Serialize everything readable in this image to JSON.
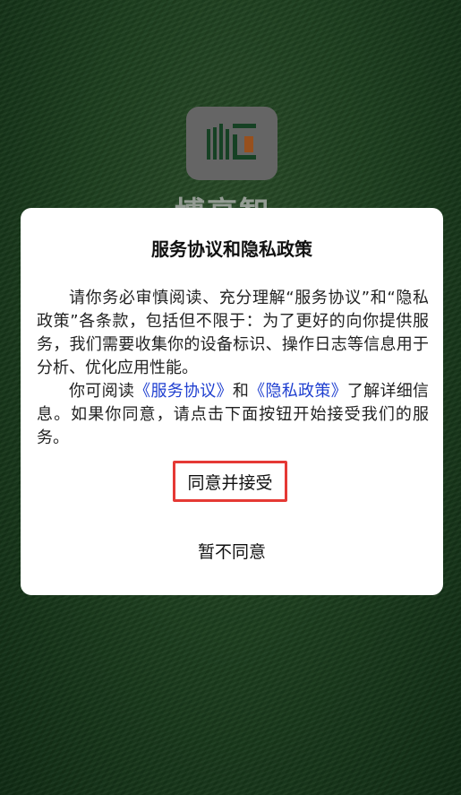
{
  "background": {
    "app_name": "博高智"
  },
  "dialog": {
    "title": "服务协议和隐私政策",
    "paragraph1": "请你务必审慎阅读、充分理解“服务协议”和“隐私政策”各条款，包括但不限于：为了更好的向你提供服务，我们需要收集你的设备标识、操作日志等信息用于分析、优化应用性能。",
    "p2_prefix": "你可阅读",
    "service_agreement_link": "《服务协议》",
    "p2_and": "和",
    "privacy_policy_link": "《隐私政策》",
    "p2_suffix": "了解详细信息。如果你同意，请点击下面按钮开始接受我们的服务。",
    "agree_label": "同意并接受",
    "decline_label": "暂不同意"
  },
  "colors": {
    "link": "#2040d0",
    "highlight_border": "#e53935",
    "logo_green": "#1f5a33",
    "logo_orange": "#d2702a"
  }
}
